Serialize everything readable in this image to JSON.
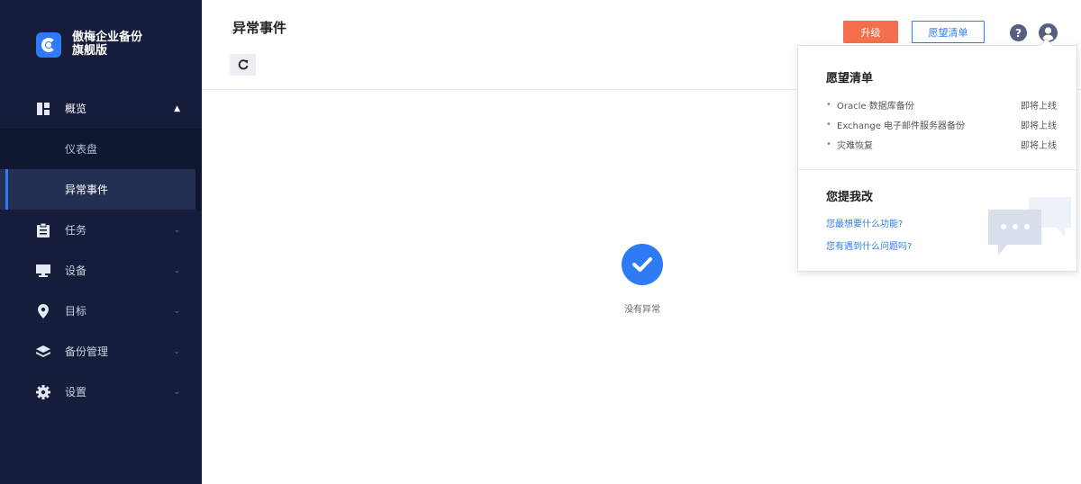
{
  "brand": {
    "name": "傲梅企业备份旗舰版",
    "logo_icon": "cbackup-logo-icon",
    "accent": "#2f7bf5"
  },
  "sidebar": {
    "items": [
      {
        "label": "概览",
        "icon": "dashboard-icon",
        "open": true,
        "children": [
          {
            "label": "仪表盘",
            "active": false
          },
          {
            "label": "异常事件",
            "active": true
          }
        ]
      },
      {
        "label": "任务",
        "icon": "clipboard-icon"
      },
      {
        "label": "设备",
        "icon": "monitor-icon"
      },
      {
        "label": "目标",
        "icon": "location-pin-icon"
      },
      {
        "label": "备份管理",
        "icon": "layers-icon"
      },
      {
        "label": "设置",
        "icon": "gear-icon"
      }
    ],
    "colors": {
      "background": "#151d3b",
      "active": "#243053"
    }
  },
  "header": {
    "title": "异常事件",
    "upgrade_label": "升级",
    "wishlist_label": "愿望清单",
    "help_icon": "help-icon",
    "user_icon": "user-avatar-icon",
    "upgrade_color": "#f46f4e"
  },
  "toolbar": {
    "refresh_icon": "refresh-icon"
  },
  "main": {
    "empty_text": "没有异常",
    "empty_icon": "check-circle-icon"
  },
  "popover": {
    "title": "愿望清单",
    "wishes": [
      {
        "name": "Oracle 数据库备份",
        "status": "即将上线"
      },
      {
        "name": "Exchange 电子邮件服务器备份",
        "status": "即将上线"
      },
      {
        "name": "灾难恢复",
        "status": "即将上线"
      }
    ],
    "feedback_title": "您提我改",
    "feedback_links": [
      "您最想要什么功能?",
      "您有遇到什么问题吗?"
    ],
    "illustration_icon": "chat-bubbles-icon"
  }
}
